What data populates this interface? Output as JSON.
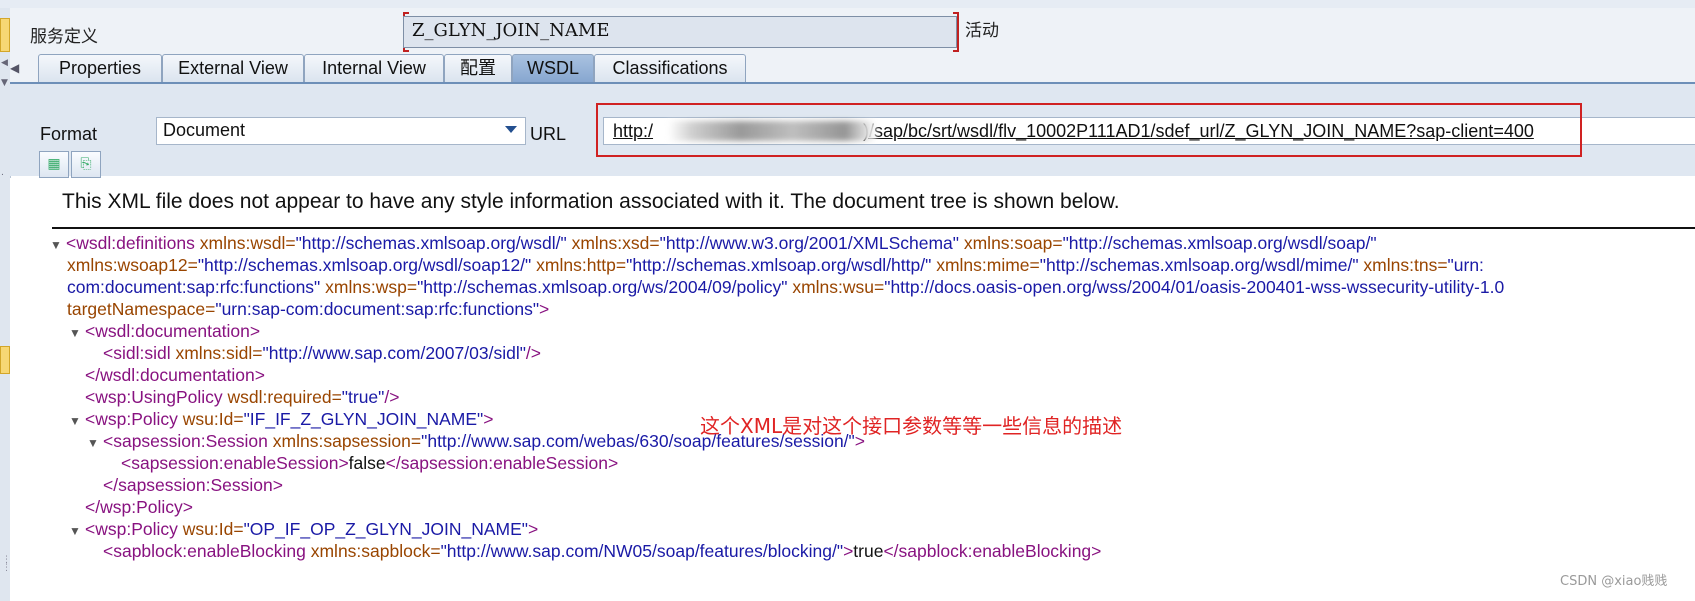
{
  "header": {
    "service_label": "服务定义",
    "service_name": "Z_GLYN_JOIN_NAME",
    "status_label": "活动"
  },
  "tabs": [
    {
      "label": "Properties"
    },
    {
      "label": "External View"
    },
    {
      "label": "Internal View"
    },
    {
      "label": "配置"
    },
    {
      "label": "WSDL",
      "active": true
    },
    {
      "label": "Classifications"
    }
  ],
  "wsdl_panel": {
    "format_label": "Format",
    "format_value": "Document",
    "url_label": "URL",
    "url_prefix": "http:/",
    "url_suffix": ")/sap/bc/srt/wsdl/flv_10002P111AD1/sdef_url/Z_GLYN_JOIN_NAME?sap-client=400"
  },
  "toolbar": {
    "button1_icon": "grid-icon",
    "button2_icon": "export-icon"
  },
  "xml_viewer": {
    "notice": "This XML file does not appear to have any style information associated with it. The document tree is shown below.",
    "lines": {
      "l1_tag": "<wsdl:definitions",
      "l1_a1n": "xmlns:wsdl=",
      "l1_a1v": "\"http://schemas.xmlsoap.org/wsdl/\"",
      "l1_a2n": "xmlns:xsd=",
      "l1_a2v": "\"http://www.w3.org/2001/XMLSchema\"",
      "l1_a3n": "xmlns:soap=",
      "l1_a3v": "\"http://schemas.xmlsoap.org/wsdl/soap/\"",
      "l2_a1n": "xmlns:wsoap12=",
      "l2_a1v": "\"http://schemas.xmlsoap.org/wsdl/soap12/\"",
      "l2_a2n": "xmlns:http=",
      "l2_a2v": "\"http://schemas.xmlsoap.org/wsdl/http/\"",
      "l2_a3n": "xmlns:mime=",
      "l2_a3v": "\"http://schemas.xmlsoap.org/wsdl/mime/\"",
      "l2_a4n": "xmlns:tns=",
      "l2_a4v": "\"urn:",
      "l3_a0v": "com:document:sap:rfc:functions\"",
      "l3_a1n": "xmlns:wsp=",
      "l3_a1v": "\"http://schemas.xmlsoap.org/ws/2004/09/policy\"",
      "l3_a2n": "xmlns:wsu=",
      "l3_a2v": "\"http://docs.oasis-open.org/wss/2004/01/oasis-200401-wss-wssecurity-utility-1.0",
      "l4_a1n": "targetNamespace=",
      "l4_a1v": "\"urn:sap-com:document:sap:rfc:functions\"",
      "l4_end": ">",
      "l5_tag": "<wsdl:documentation>",
      "l6_tag": "<sidl:sidl",
      "l6_a1n": "xmlns:sidl=",
      "l6_a1v": "\"http://www.sap.com/2007/03/sidl\"",
      "l6_end": "/>",
      "l7_tag": "</wsdl:documentation>",
      "l8_tag": "<wsp:UsingPolicy",
      "l8_a1n": "wsdl:required=",
      "l8_a1v": "\"true\"",
      "l8_end": "/>",
      "l9_tag": "<wsp:Policy",
      "l9_a1n": "wsu:Id=",
      "l9_a1v": "\"IF_IF_Z_GLYN_JOIN_NAME\"",
      "l9_end": ">",
      "l10_tag": "<sapsession:Session",
      "l10_a1n": "xmlns:sapsession=",
      "l10_a1v": "\"http://www.sap.com/webas/630/soap/features/session/\"",
      "l10_end": ">",
      "l11_open": "<sapsession:enableSession>",
      "l11_text": "false",
      "l11_close": "</sapsession:enableSession>",
      "l12_tag": "</sapsession:Session>",
      "l13_tag": "</wsp:Policy>",
      "l14_tag": "<wsp:Policy",
      "l14_a1n": "wsu:Id=",
      "l14_a1v": "\"OP_IF_OP_Z_GLYN_JOIN_NAME\"",
      "l14_end": ">",
      "l15_open": "<sapblock:enableBlocking",
      "l15_a1n": "xmlns:sapblock=",
      "l15_a1v": "\"http://www.sap.com/NW05/soap/features/blocking/\"",
      "l15_mid": ">",
      "l15_text": "true",
      "l15_close": "</sapblock:enableBlocking>"
    }
  },
  "annotation": "这个XML是对这个接口参数等等一些信息的描述",
  "watermark": "CSDN @xiao贱贱",
  "colors": {
    "tag": "#881280",
    "attr_name": "#994500",
    "attr_value": "#1a1aa6",
    "annotation": "#e02424",
    "active_tab": "#87a7d0"
  }
}
